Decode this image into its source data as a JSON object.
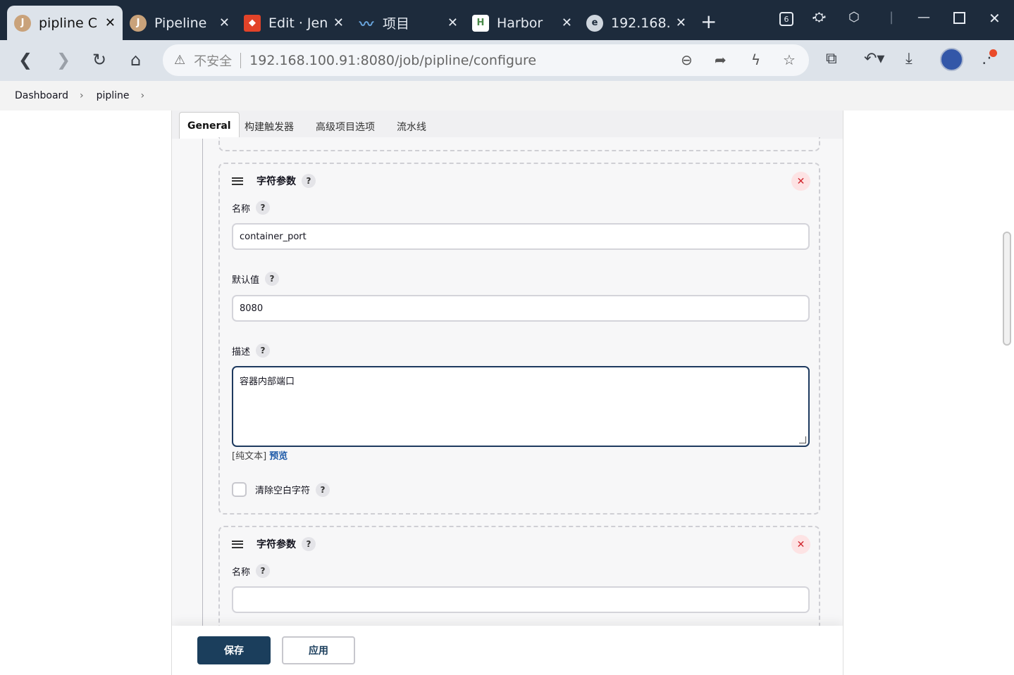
{
  "browser": {
    "tabs": [
      {
        "title": "pipline C",
        "active": true
      },
      {
        "title": "Pipeline",
        "active": false
      },
      {
        "title": "Edit · Jen",
        "active": false
      },
      {
        "title": "项目",
        "active": false
      },
      {
        "title": "Harbor",
        "active": false
      },
      {
        "title": "192.168.",
        "active": false
      }
    ],
    "new_tab": "+",
    "close": "✕",
    "tab_count_badge": "6",
    "address": {
      "insecure_label": "不安全",
      "url": "192.168.100.91:8080/job/pipline/configure"
    }
  },
  "breadcrumb": {
    "items": [
      "Dashboard",
      "pipline"
    ],
    "separator": "›"
  },
  "config_tabs": [
    "General",
    "构建触发器",
    "高级项目选项",
    "流水线"
  ],
  "params": [
    {
      "title": "字符参数",
      "help": "?",
      "delete": "✕",
      "name_label": "名称",
      "name_value": "container_port",
      "default_label": "默认值",
      "default_value": "8080",
      "desc_label": "描述",
      "desc_value": "容器内部端口",
      "format_plain": "[纯文本]",
      "format_preview": "预览",
      "trim_label": "清除空白字符"
    },
    {
      "title": "字符参数",
      "help": "?",
      "delete": "✕",
      "name_label": "名称",
      "name_value": ""
    }
  ],
  "buttons": {
    "save": "保存",
    "apply": "应用"
  },
  "icons": {
    "back": "back-icon",
    "forward": "forward-icon",
    "reload": "reload-icon",
    "home": "home-icon",
    "warning": "warning-icon",
    "zoom": "zoom-out-icon",
    "share": "share-icon",
    "bolt": "bolt-icon",
    "star": "star-icon",
    "extensions": "puzzle-icon",
    "history": "undo-icon",
    "download": "download-icon",
    "menu": "more-icon"
  },
  "colors": {
    "accent": "#1b3e5c",
    "delete": "#d0252c",
    "link": "#1e5aa8",
    "chrome": "#1d2b3c"
  }
}
